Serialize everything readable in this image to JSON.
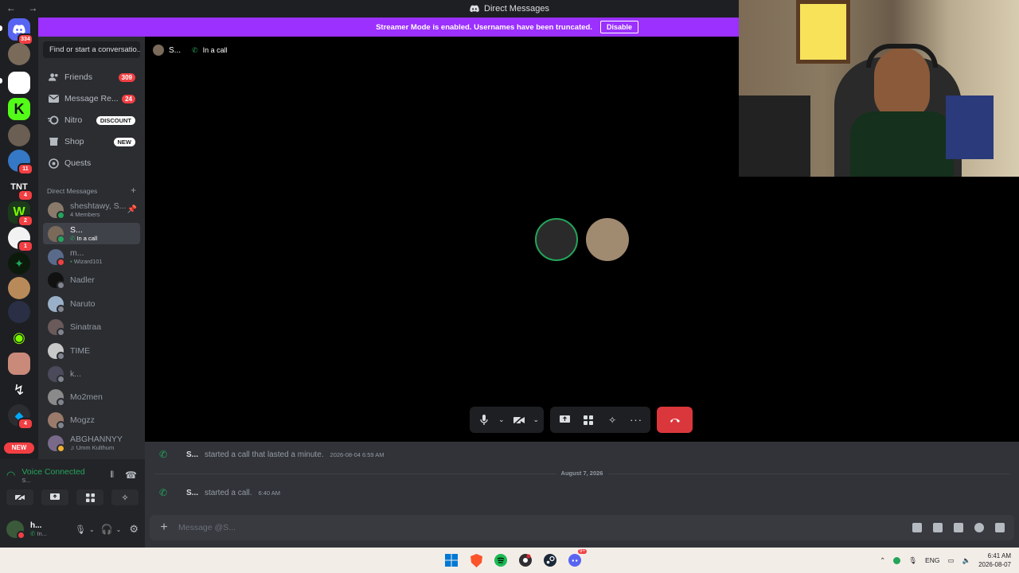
{
  "window": {
    "title": "Direct Messages",
    "nav_arrows": "← →"
  },
  "banner": {
    "text": "Streamer Mode is enabled. Usernames have been truncated.",
    "button": "Disable"
  },
  "servers": {
    "home_badge": "334",
    "badges": [
      "11",
      "4",
      "2",
      "1",
      "4"
    ],
    "new_label": "NEW"
  },
  "sidebar": {
    "search_placeholder": "Find or start a conversatio...",
    "nav": [
      {
        "label": "Friends",
        "count": "309",
        "icon": "friends-icon"
      },
      {
        "label": "Message Re...",
        "count": "24",
        "icon": "mail-icon"
      },
      {
        "label": "Nitro",
        "tag": "DISCOUNT",
        "icon": "nitro-icon"
      },
      {
        "label": "Shop",
        "tag": "NEW",
        "icon": "shop-icon"
      },
      {
        "label": "Quests",
        "icon": "quests-icon"
      }
    ],
    "dm_header": "Direct Messages",
    "dm_add": "+",
    "dms": [
      {
        "name": "sheshtawy, S...",
        "sub": "4 Members"
      },
      {
        "name": "S...",
        "sub": "In a call"
      },
      {
        "name": "m...",
        "sub": "Wizard101"
      },
      {
        "name": "Nadler",
        "sub": ""
      },
      {
        "name": "Naruto",
        "sub": ""
      },
      {
        "name": "Sinatraa",
        "sub": ""
      },
      {
        "name": "TIME",
        "sub": ""
      },
      {
        "name": "k...",
        "sub": ""
      },
      {
        "name": "Mo2men",
        "sub": ""
      },
      {
        "name": "Mogzz",
        "sub": ""
      },
      {
        "name": "ABGHANNYY",
        "sub": "Umm Kulthum"
      }
    ]
  },
  "voice": {
    "status": "Voice Connected",
    "channel": "S..."
  },
  "user": {
    "name": "h...",
    "status": "In..."
  },
  "call": {
    "user": "S...",
    "status": "In a call"
  },
  "chat": {
    "messages": [
      {
        "who": "S...",
        "text": "started a call that lasted a minute.",
        "time": "2026-08-04 6:59 AM"
      },
      {
        "who": "S...",
        "text": "started a call.",
        "time": "6:40 AM"
      }
    ],
    "date_divider": "August 7, 2026",
    "placeholder": "Message @S..."
  },
  "taskbar": {
    "lang": "ENG",
    "time": "6:41 AM",
    "date": "2026-08-07",
    "notif_badge": "9+"
  },
  "colors": {
    "accent": "#9b30ff",
    "green": "#23a55a",
    "red": "#da373c",
    "badge": "#f23f43"
  }
}
